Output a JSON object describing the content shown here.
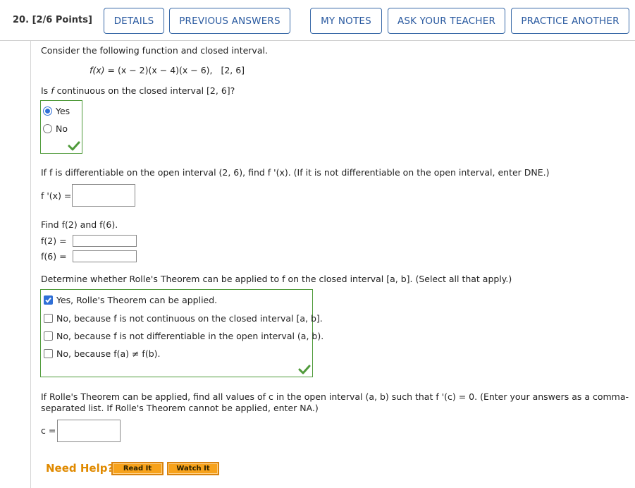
{
  "header": {
    "question_number": "20.",
    "points": "[2/6 Points]",
    "buttons": {
      "details": "DETAILS",
      "previous_answers": "PREVIOUS ANSWERS",
      "my_notes": "MY NOTES",
      "ask_teacher": "ASK YOUR TEACHER",
      "practice_another": "PRACTICE ANOTHER"
    }
  },
  "problem": {
    "intro": "Consider the following function and closed interval.",
    "function_lhs": "f(x)",
    "function_rhs": " = (x − 2)(x − 4)(x − 6),",
    "interval": "[2, 6]"
  },
  "part1": {
    "question_prefix": "Is ",
    "question_f": "f",
    "question_suffix": " continuous on the closed interval [2, 6]?",
    "options": [
      "Yes",
      "No"
    ],
    "selected_index": 0,
    "status": "correct"
  },
  "part2": {
    "question": "If f is differentiable on the open interval (2, 6), find f '(x). (If it is not differentiable on the open interval, enter DNE.)",
    "input_label": "f '(x) =",
    "input_value": ""
  },
  "part3": {
    "question": "Find f(2) and f(6).",
    "f2_label": "f(2) =",
    "f2_value": "",
    "f6_label": "f(6) =",
    "f6_value": ""
  },
  "part4": {
    "question": "Determine whether Rolle's Theorem can be applied to f on the closed interval [a, b]. (Select all that apply.)",
    "options": [
      "Yes, Rolle's Theorem can be applied.",
      "No, because f is not continuous on the closed interval [a, b].",
      "No, because f is not differentiable in the open interval (a, b).",
      "No, because f(a) ≠ f(b)."
    ],
    "checked": [
      true,
      false,
      false,
      false
    ],
    "status": "correct"
  },
  "part5": {
    "question_line1": "If Rolle's Theorem can be applied, find all values of c in the open interval (a, b) such that f '(c) = 0. (Enter your answers as a comma-",
    "question_line2": "separated list. If Rolle's Theorem cannot be applied, enter NA.)",
    "input_label": "c =",
    "input_value": ""
  },
  "help": {
    "label": "Need Help?",
    "read_it": "Read It",
    "watch_it": "Watch It"
  },
  "colors": {
    "link_blue": "#2a5aa0",
    "correct_green": "#4f9a3a",
    "help_orange": "#e08a00"
  }
}
